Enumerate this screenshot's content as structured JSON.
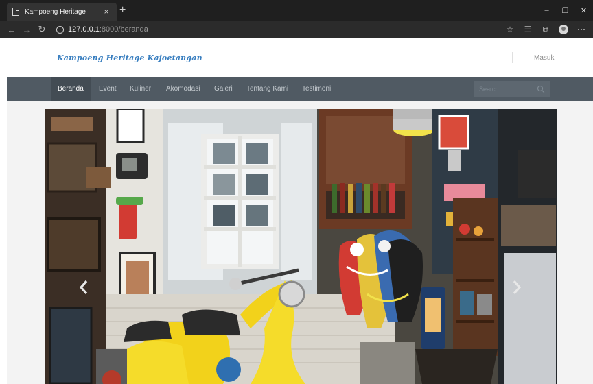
{
  "browser": {
    "tab_title": "Kampoeng Heritage",
    "tab_close": "×",
    "new_tab": "+",
    "url_host": "127.0.0.1",
    "url_rest": ":8000/beranda",
    "controls": {
      "minimize": "–",
      "restore": "❐",
      "close": "✕"
    },
    "nav": {
      "back": "←",
      "forward": "→",
      "reload": "↻"
    },
    "addr_icons": {
      "favorite": "☆",
      "favorites": "☰",
      "collections": "⧉",
      "more": "⋯"
    }
  },
  "site": {
    "brand": "Kampoeng Heritage Kajoetangan",
    "login": "Masuk",
    "nav": [
      {
        "label": "Beranda",
        "active": true
      },
      {
        "label": "Event",
        "active": false
      },
      {
        "label": "Kuliner",
        "active": false
      },
      {
        "label": "Akomodasi",
        "active": false
      },
      {
        "label": "Galeri",
        "active": false
      },
      {
        "label": "Tentang Kami",
        "active": false
      },
      {
        "label": "Testimoni",
        "active": false
      }
    ],
    "search": {
      "placeholder": "Search",
      "value": ""
    },
    "colors": {
      "navbar": "#505a63",
      "brand": "#3a7fc0",
      "active_nav": "#434c54"
    }
  },
  "carousel": {
    "image_subject": "vintage room with yellow scooter, wayang puppets, window and shelves",
    "prev_icon": "chevron-left-icon",
    "next_icon": "chevron-right-icon"
  }
}
